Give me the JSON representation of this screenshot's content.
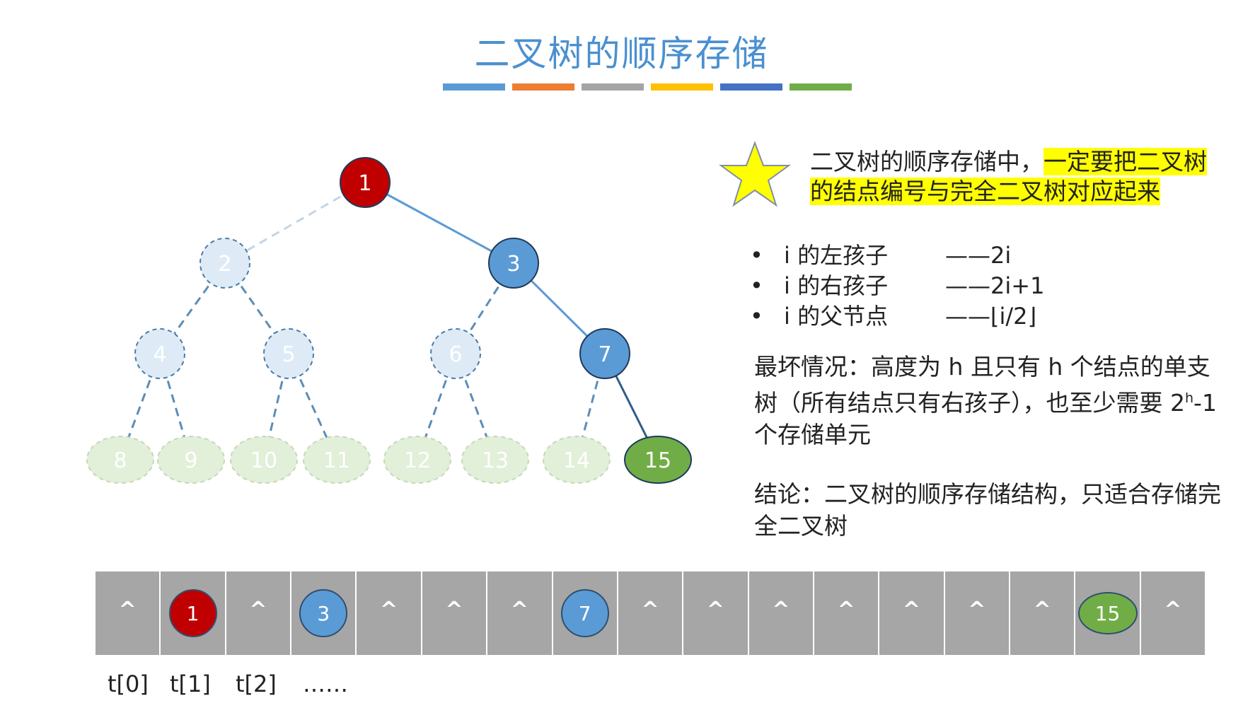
{
  "title": "二叉树的顺序存储",
  "color_bar": [
    "#5b9bd5",
    "#ed7d31",
    "#a5a5a5",
    "#ffc000",
    "#4472c4",
    "#70ad47"
  ],
  "tree": {
    "nodes": [
      {
        "label": "1",
        "style": "red"
      },
      {
        "label": "2",
        "style": "ghost-blue"
      },
      {
        "label": "3",
        "style": "blue"
      },
      {
        "label": "4",
        "style": "ghost-blue"
      },
      {
        "label": "5",
        "style": "ghost-blue"
      },
      {
        "label": "6",
        "style": "ghost-blue"
      },
      {
        "label": "7",
        "style": "blue"
      },
      {
        "label": "8",
        "style": "ghost-green"
      },
      {
        "label": "9",
        "style": "ghost-green"
      },
      {
        "label": "10",
        "style": "ghost-green"
      },
      {
        "label": "11",
        "style": "ghost-green"
      },
      {
        "label": "12",
        "style": "ghost-green"
      },
      {
        "label": "13",
        "style": "ghost-green"
      },
      {
        "label": "14",
        "style": "ghost-green"
      },
      {
        "label": "15",
        "style": "green"
      }
    ]
  },
  "key_note": {
    "plain": "二叉树的顺序存储中，",
    "highlight": "一定要把二叉树的结点编号与完全二叉树对应起来"
  },
  "rules": [
    {
      "bullet": "•",
      "label": "i 的左孩子",
      "formula": "——2i"
    },
    {
      "bullet": "•",
      "label": "i 的右孩子",
      "formula": "——2i+1"
    },
    {
      "bullet": "•",
      "label": "i 的父节点",
      "formula": "——⌊i/2⌋"
    }
  ],
  "worst_case": {
    "part1": "最坏情况：高度为 h 且只有 h 个结点的单支树（所有结点只有右孩子），也至少需要 2",
    "sup": "h",
    "part2": "-1 个存储单元"
  },
  "conclusion": "结论：二叉树的顺序存储结构，只适合存储完全二叉树",
  "storage_array": {
    "cells": [
      "^",
      "1",
      "^",
      "3",
      "^",
      "^",
      "^",
      "7",
      "^",
      "^",
      "^",
      "^",
      "^",
      "^",
      "^",
      "15",
      "^"
    ],
    "null_symbol": "^"
  },
  "index_labels": [
    "t[0]",
    "t[1]",
    "t[2]",
    "……"
  ],
  "colors": {
    "title": "#4a90d0",
    "red_node": "#c00000",
    "blue_node": "#5b9bd5",
    "green_node": "#70ad47",
    "highlight": "#ffff00",
    "array_bg": "#a6a6a6"
  }
}
